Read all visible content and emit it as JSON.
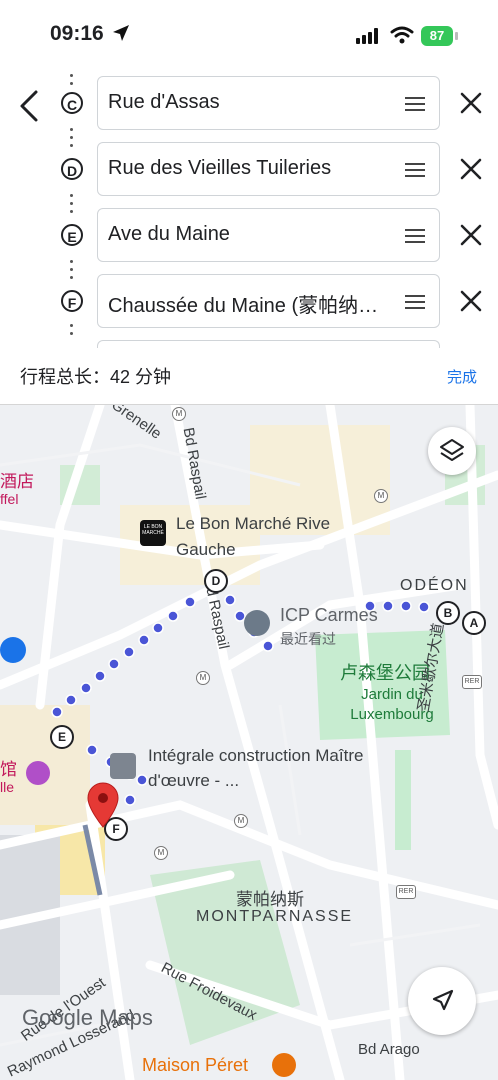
{
  "status_bar": {
    "time": "09:16",
    "battery": "87"
  },
  "stops": [
    {
      "letter": "C",
      "name": "Rue d'Assas"
    },
    {
      "letter": "D",
      "name": "Rue des Vieilles Tuileries"
    },
    {
      "letter": "E",
      "name": "Ave du Maine"
    },
    {
      "letter": "F",
      "name": "Chaussée du Maine (蒙帕纳…"
    }
  ],
  "trip": {
    "total_label": "行程总长：42 分钟",
    "done_label": "完成"
  },
  "map": {
    "labels": {
      "grenelle": "Grenelle",
      "raspail_top": "Bd Raspail",
      "raspail_mid": "Bd Raspail",
      "hotel": "酒店",
      "hotel_sub": "ffel",
      "bon_marche": "Le Bon Marché Rive Gauche",
      "bon_marche_logo": "LE BON MARCHÉ",
      "odeon": "ODÉON",
      "icp": "ICP Carmes",
      "icp_sub": "最近看过",
      "luxembourg_cn": "卢森堡公园",
      "luxembourg": "Jardin du Luxembourg",
      "integrale": "Intégrale construction Maître d'œuvre - ...",
      "st_michel": "圣米歇尔大道",
      "montparnasse_cn": "蒙帕纳斯",
      "montparnasse": "MONTPARNASSE",
      "rue_ouest": "Rue de l'Ouest",
      "rue_froidevaux": "Rue Froidevaux",
      "raymond": "Raymond Losserand",
      "maison_peret": "Maison Péret",
      "bd_arago": "Bd Arago",
      "guan": "馆",
      "lle": "lle",
      "rer": "RER",
      "metro": "M"
    },
    "markers": [
      "A",
      "B",
      "D",
      "E",
      "F"
    ],
    "attribution": {
      "google": "Google",
      "maps": "Maps"
    },
    "colors": {
      "route": "#4a55d6",
      "park": "#c7ecd0",
      "pin": "#e53935",
      "accent": "#1a73e8"
    }
  }
}
